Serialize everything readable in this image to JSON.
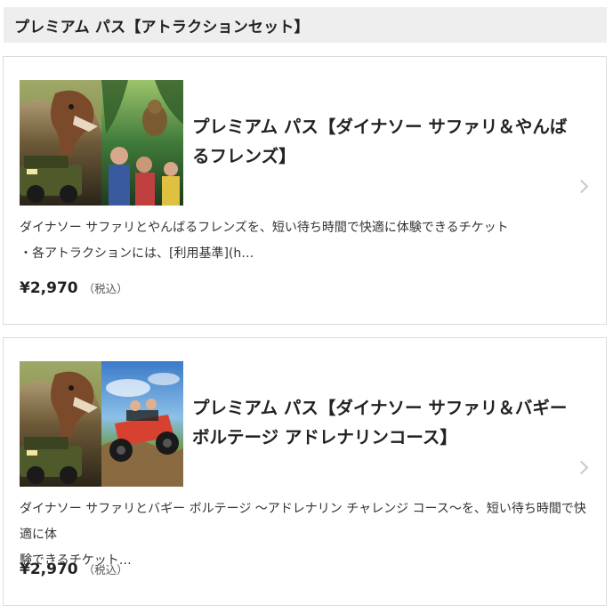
{
  "section": {
    "title": "プレミアム パス【アトラクションセット】"
  },
  "cards": [
    {
      "title": "プレミアム パス【ダイナソー サファリ＆やんばるフレンズ】",
      "description_lines": [
        "ダイナソー サファリとやんばるフレンズを、短い待ち時間で快適に体験できるチケット",
        "・各アトラクションには、[利用基準](h…"
      ],
      "price": "¥2,970",
      "tax_note": "（税込）",
      "image_left": "dinosaur-safari-jeep",
      "image_right": "yambaru-friends-jungle"
    },
    {
      "title": "プレミアム パス【ダイナソー サファリ＆バギー ボルテージ アドレナリンコース】",
      "description_lines": [
        "ダイナソー サファリとバギー ボルテージ ～アドレナリン チャレンジ コース～を、短い待ち時間で快適に体",
        "験できるチケット…"
      ],
      "price": "¥2,970",
      "tax_note": "（税込）",
      "image_left": "dinosaur-safari-jeep",
      "image_right": "buggy-voltage-offroad"
    }
  ],
  "colors": {
    "header_bg": "#eeeeee",
    "card_border": "#dcdcdc",
    "chevron": "#c8c8c8",
    "text": "#222222"
  }
}
